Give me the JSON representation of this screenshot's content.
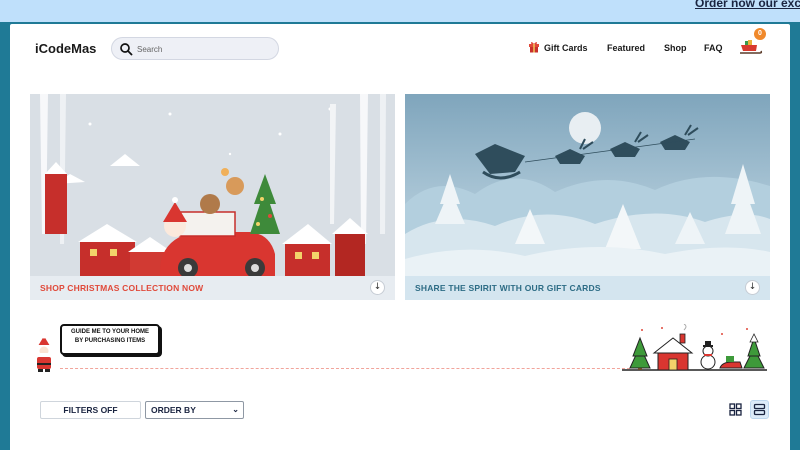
{
  "topbar": {
    "promo_text": "Order now our exclusive"
  },
  "header": {
    "logo": "iCodeMas",
    "search": {
      "placeholder": "Search",
      "value": ""
    },
    "nav": {
      "gift_cards": "Gift Cards",
      "featured": "Featured",
      "shop": "Shop",
      "faq": "FAQ"
    },
    "cart": {
      "count": "0"
    }
  },
  "banners": [
    {
      "caption": "SHOP CHRISTMAS COLLECTION NOW",
      "arrow": "↓"
    },
    {
      "caption": "SHARE THE SPIRIT WITH OUR GIFT CARDS",
      "arrow": "↓"
    }
  ],
  "guide": {
    "bubble_text": "GUIDE ME TO YOUR HOME BY PURCHASING ITEMS"
  },
  "toolbar": {
    "filters_label": "FILTERS OFF",
    "order_label": "ORDER BY",
    "order_chevron": "⌄"
  },
  "colors": {
    "accent_red": "#e0493a",
    "accent_teal": "#2d6c85",
    "badge_orange": "#f0892b",
    "frame_teal": "#1f7a96",
    "topbar_blue": "#bfe0fb"
  },
  "icons": {
    "search": "search-icon",
    "gift": "gift-icon",
    "cart": "sleigh-cart-icon",
    "grid_view": "grid-view-icon",
    "list_view": "list-view-icon"
  }
}
